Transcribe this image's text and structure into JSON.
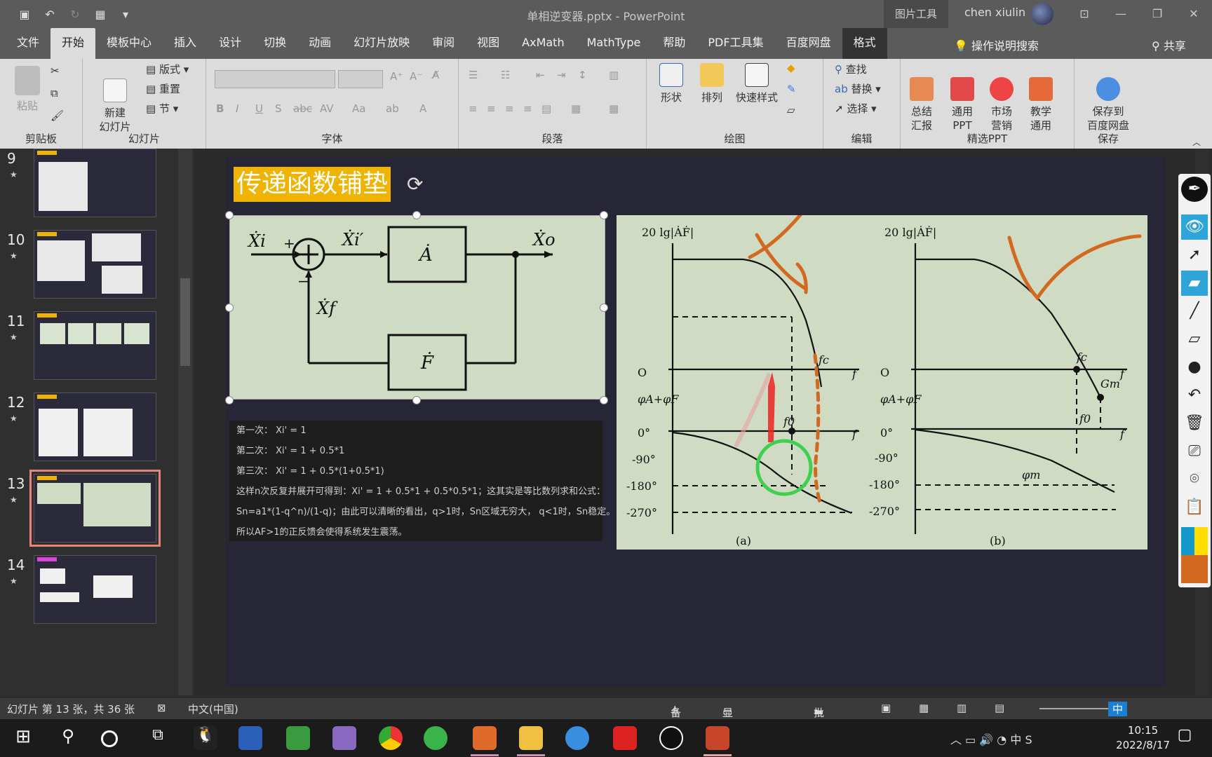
{
  "window": {
    "title": "单相逆变器.pptx - PowerPoint",
    "context_tools": "图片工具",
    "user": "chen xiulin"
  },
  "tabs": [
    "文件",
    "开始",
    "模板中心",
    "插入",
    "设计",
    "切换",
    "动画",
    "幻灯片放映",
    "审阅",
    "视图",
    "AxMath",
    "MathType",
    "帮助",
    "PDF工具集",
    "百度网盘",
    "格式"
  ],
  "active_tab": "开始",
  "tellme": "操作说明搜索",
  "share": "共享",
  "ribbon": {
    "clipboard": {
      "paste": "粘贴",
      "label": "剪贴板"
    },
    "slides": {
      "new_slide": "新建\n幻灯片",
      "layout": "版式",
      "reset": "重置",
      "section": "节",
      "label": "幻灯片"
    },
    "font": {
      "label": "字体"
    },
    "paragraph": {
      "label": "段落"
    },
    "drawing": {
      "shapes": "形状",
      "arrange": "排列",
      "quick_styles": "快速样式",
      "label": "绘图"
    },
    "editing": {
      "find": "查找",
      "replace": "替换",
      "select": "选择",
      "label": "编辑"
    },
    "featured": {
      "summary": "总结\n汇报",
      "general": "通用\nPPT",
      "marketing": "市场\n营销",
      "teaching": "教学\n通用",
      "label": "精选PPT"
    },
    "save": {
      "save_baidu": "保存到\n百度网盘",
      "label": "保存"
    }
  },
  "thumbnails": [
    {
      "num": "9",
      "star": "★"
    },
    {
      "num": "10",
      "star": "★"
    },
    {
      "num": "11",
      "star": "★"
    },
    {
      "num": "12",
      "star": "★"
    },
    {
      "num": "13",
      "star": "★"
    },
    {
      "num": "14",
      "star": "★"
    }
  ],
  "slide": {
    "title": "传递函数铺垫",
    "block_diagram": {
      "input": "Ẋi",
      "plus": "+",
      "minus": "−",
      "error": "Ẋi′",
      "forward": "Ȧ",
      "output": "Ẋo",
      "feedback_signal": "Ẋf",
      "feedback": "Ḟ"
    },
    "bode": {
      "mag_label": "20 lg|ȦḞ|",
      "phase_label": "φA+φF",
      "origin": "O",
      "f": "f",
      "fc": "fc",
      "f0": "f0",
      "gm": "Gm",
      "phim": "φm",
      "ticks": [
        "0°",
        "-90°",
        "-180°",
        "-270°"
      ],
      "caption_a": "(a)",
      "caption_b": "(b)"
    },
    "notes": [
      "第一次：  Xi' = 1",
      "第二次：  Xi' = 1 + 0.5*1",
      "第三次：  Xi' = 1 + 0.5*(1+0.5*1)",
      "这样n次反复并展开可得到：Xi' = 1 + 0.5*1 + 0.5*0.5*1；这其实是等比数列求和公式：",
      "Sn=a1*(1-q^n)/(1-q)；由此可以清晰的看出，q>1时，Sn区域无穷大， q<1时，Sn稳定。",
      "所以AF>1的正反馈会使得系统发生震荡。"
    ]
  },
  "status": {
    "slide_info": "幻灯片 第 13 张，共 36 张",
    "language": "中文(中国)",
    "notes": "备注",
    "display": "显示器设置",
    "comments": "批注"
  },
  "taskbar": {
    "time": "10:15",
    "date": "2022/8/17",
    "ime": "中"
  },
  "colors": {
    "title_bg": "#f0b400",
    "diagram_bg": "#cfdcc3",
    "slide_bg": "#272636",
    "annotation_orange": "#d2691e",
    "selected_outline": "#e8837a"
  }
}
